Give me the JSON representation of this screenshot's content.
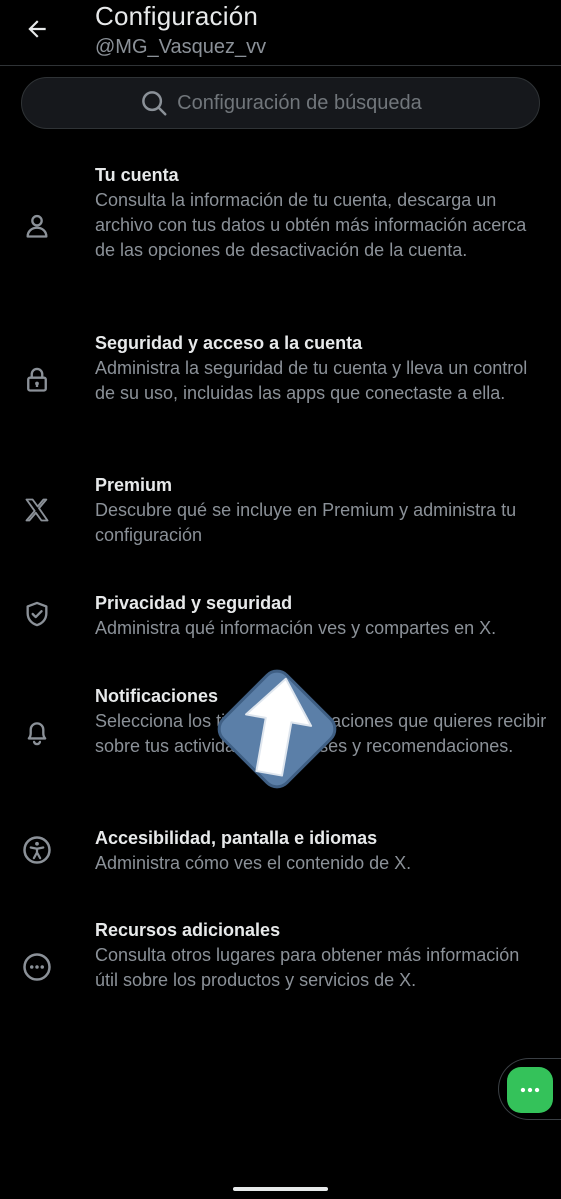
{
  "header": {
    "title": "Configuración",
    "username": "@MG_Vasquez_vv"
  },
  "search": {
    "placeholder": "Configuración de búsqueda"
  },
  "settings": [
    {
      "icon": "person-icon",
      "title": "Tu cuenta",
      "description": "Consulta la información de tu cuenta, descarga un archivo con tus datos u obtén más información acerca de las opciones de desactivación de la cuenta."
    },
    {
      "icon": "lock-icon",
      "title": "Seguridad y acceso a la cuenta",
      "description": "Administra la seguridad de tu cuenta y lleva un control de su uso, incluidas las apps que conectaste a ella."
    },
    {
      "icon": "x-logo-icon",
      "title": "Premium",
      "description": "Descubre qué se incluye en Premium y administra tu configuración"
    },
    {
      "icon": "shield-check-icon",
      "title": "Privacidad y seguridad",
      "description": "Administra qué información ves y compartes en X."
    },
    {
      "icon": "bell-icon",
      "title": "Notificaciones",
      "description": "Selecciona los tipos de notificaciones que quieres recibir sobre tus actividades, intereses y recomendaciones."
    },
    {
      "icon": "accessibility-icon",
      "title": "Accesibilidad, pantalla e idiomas",
      "description": "Administra cómo ves el contenido de X."
    },
    {
      "icon": "more-circle-icon",
      "title": "Recursos adicionales",
      "description": "Consulta otros lugares para obtener más información útil sobre los productos y servicios de X."
    }
  ],
  "colors": {
    "background": "#000000",
    "primary_text": "#e7e9ea",
    "secondary_text": "#8b9198",
    "fab": "#34c25a",
    "arrow_overlay": "#5b7fa8"
  }
}
